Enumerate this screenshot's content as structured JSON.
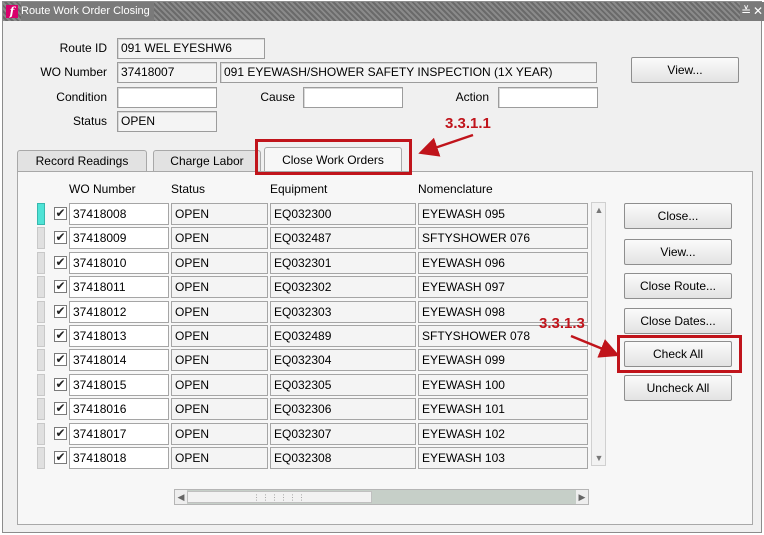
{
  "window": {
    "title": "Route Work Order Closing",
    "minimize_glyph": "≚",
    "close_glyph": "✕",
    "app_icon": "oracle-forms-icon",
    "app_icon_glyph": "f"
  },
  "header": {
    "route_id_label": "Route ID",
    "route_id_value": "091 WEL EYESHW6",
    "wo_number_label": "WO Number",
    "wo_number_value": "37418007",
    "wo_description": "091 EYEWASH/SHOWER SAFETY INSPECTION (1X YEAR)",
    "condition_label": "Condition",
    "condition_value": "",
    "cause_label": "Cause",
    "cause_value": "",
    "action_label": "Action",
    "action_value": "",
    "status_label": "Status",
    "status_value": "OPEN",
    "view_button": "View..."
  },
  "tabs": [
    {
      "label": "Record Readings",
      "active": false
    },
    {
      "label": "Charge Labor",
      "active": false
    },
    {
      "label": "Close Work Orders",
      "active": true
    }
  ],
  "table": {
    "columns": [
      "WO Number",
      "Status",
      "Equipment",
      "Nomenclature"
    ],
    "rows": [
      {
        "checked": true,
        "wo": "37418008",
        "status": "OPEN",
        "equipment": "EQ032300",
        "nomenclature": "EYEWASH 095"
      },
      {
        "checked": true,
        "wo": "37418009",
        "status": "OPEN",
        "equipment": "EQ032487",
        "nomenclature": "SFTYSHOWER 076"
      },
      {
        "checked": true,
        "wo": "37418010",
        "status": "OPEN",
        "equipment": "EQ032301",
        "nomenclature": "EYEWASH 096"
      },
      {
        "checked": true,
        "wo": "37418011",
        "status": "OPEN",
        "equipment": "EQ032302",
        "nomenclature": "EYEWASH 097"
      },
      {
        "checked": true,
        "wo": "37418012",
        "status": "OPEN",
        "equipment": "EQ032303",
        "nomenclature": "EYEWASH 098"
      },
      {
        "checked": true,
        "wo": "37418013",
        "status": "OPEN",
        "equipment": "EQ032489",
        "nomenclature": "SFTYSHOWER 078"
      },
      {
        "checked": true,
        "wo": "37418014",
        "status": "OPEN",
        "equipment": "EQ032304",
        "nomenclature": "EYEWASH 099"
      },
      {
        "checked": true,
        "wo": "37418015",
        "status": "OPEN",
        "equipment": "EQ032305",
        "nomenclature": "EYEWASH 100"
      },
      {
        "checked": true,
        "wo": "37418016",
        "status": "OPEN",
        "equipment": "EQ032306",
        "nomenclature": "EYEWASH 101"
      },
      {
        "checked": true,
        "wo": "37418017",
        "status": "OPEN",
        "equipment": "EQ032307",
        "nomenclature": "EYEWASH 102"
      },
      {
        "checked": true,
        "wo": "37418018",
        "status": "OPEN",
        "equipment": "EQ032308",
        "nomenclature": "EYEWASH 103"
      }
    ]
  },
  "actions": {
    "close": "Close...",
    "view": "View...",
    "close_route": "Close Route...",
    "close_dates": "Close Dates...",
    "check_all": "Check All",
    "uncheck_all": "Uncheck All"
  },
  "callouts": {
    "tab_callout": "3.3.1.1",
    "check_all_callout": "3.3.1.3",
    "color": "#c0141b"
  }
}
